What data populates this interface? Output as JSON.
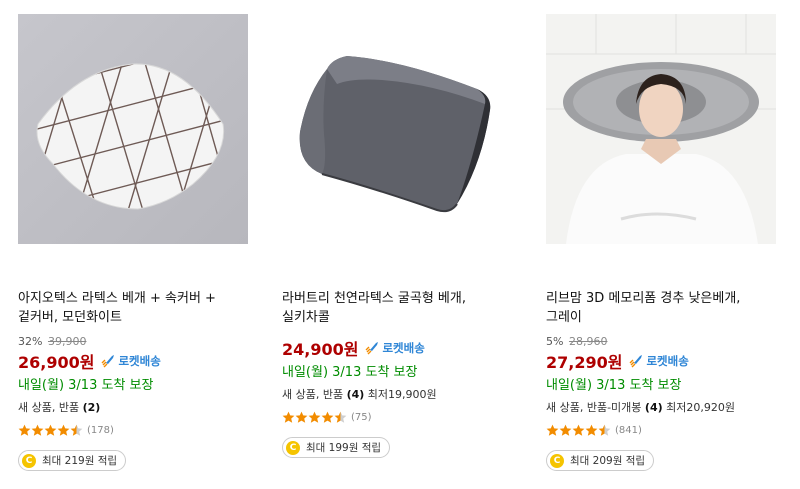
{
  "colors": {
    "price_red": "#ae0000",
    "arrival_green": "#008c00",
    "rocket_blue": "#2f86d6",
    "star_orange": "#f28c00",
    "coin_yellow": "#f5c400"
  },
  "products": [
    {
      "title": "아지오텍스 라텍스 베개 + 속커버 + 겉커버, 모던화이트",
      "discount": "32%",
      "original_price": "39,900",
      "price": "26,900원",
      "delivery_badge": "로켓배송",
      "arrival": "내일(월) 3/13 도착 보장",
      "meta_prefix": "새 상품, 반품 ",
      "meta_count": "(2)",
      "meta_suffix": "",
      "rating": 4.5,
      "review_count": "(178)",
      "reward": "최대 219원 적립",
      "image_icon": "white-triangle-pattern-pillow"
    },
    {
      "title": "라버트리 천연라텍스 굴곡형 베개, 실키차콜",
      "discount": "",
      "original_price": "",
      "price": "24,900원",
      "delivery_badge": "로켓배송",
      "arrival": "내일(월) 3/13 도착 보장",
      "meta_prefix": "새 상품, 반품 ",
      "meta_count": "(4)",
      "meta_suffix": " 최저19,900원",
      "rating": 4.5,
      "review_count": "(75)",
      "reward": "최대 199원 적립",
      "image_icon": "charcoal-contour-pillow"
    },
    {
      "title": "리브맘 3D 메모리폼 경추 낮은베개, 그레이",
      "discount": "5%",
      "original_price": "28,960",
      "price": "27,290원",
      "delivery_badge": "로켓배송",
      "arrival": "내일(월) 3/13 도착 보장",
      "meta_prefix": "새 상품, 반품-미개봉 ",
      "meta_count": "(4)",
      "meta_suffix": " 최저20,920원",
      "rating": 4.5,
      "review_count": "(841)",
      "reward": "최대 209원 적립",
      "image_icon": "woman-sleeping-on-gray-pillow"
    }
  ]
}
